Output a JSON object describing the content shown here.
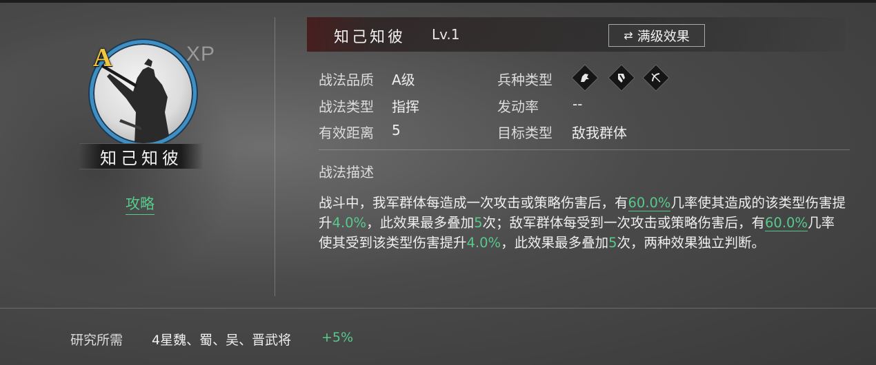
{
  "skill": {
    "name": "知己知彼",
    "level": "Lv.1",
    "grade_letter": "A",
    "xp_label": "XP",
    "guide_link": "攻略",
    "max_level_button": "满级效果"
  },
  "attributes": {
    "quality_label": "战法品质",
    "quality_value": "A级",
    "type_label": "战法类型",
    "type_value": "指挥",
    "range_label": "有效距离",
    "range_value": "5",
    "troop_label": "兵种类型",
    "troop_icons": [
      "cavalry-icon",
      "shield-icon",
      "archer-icon"
    ],
    "rate_label": "发动率",
    "rate_value": "--",
    "target_label": "目标类型",
    "target_value": "敌我群体"
  },
  "description": {
    "title": "战法描述",
    "segments": {
      "s1": "战斗中，我军群体每造成一次攻击或策略伤害后，有",
      "v1": "60.0%",
      "s2": "几率使其造成的该类型伤害提升",
      "v2": "4.0%",
      "s3": "，此效果最多叠加",
      "v3": "5",
      "s4": "次；敌军群体每受到一次攻击或策略伤害后，有",
      "v4": "60.0%",
      "s5": "几率使其受到该类型伤害提升",
      "v5": "4.0%",
      "s6": "，此效果最多叠加",
      "v6": "5",
      "s7": "次，两种效果独立判断。"
    }
  },
  "research": {
    "label": "研究所需",
    "value": "4星魏、蜀、吴、晋武将",
    "bonus": "+5%"
  },
  "colors": {
    "highlight": "#58c98c",
    "grade": "#f0c640",
    "ring": "#3d8fc4"
  }
}
